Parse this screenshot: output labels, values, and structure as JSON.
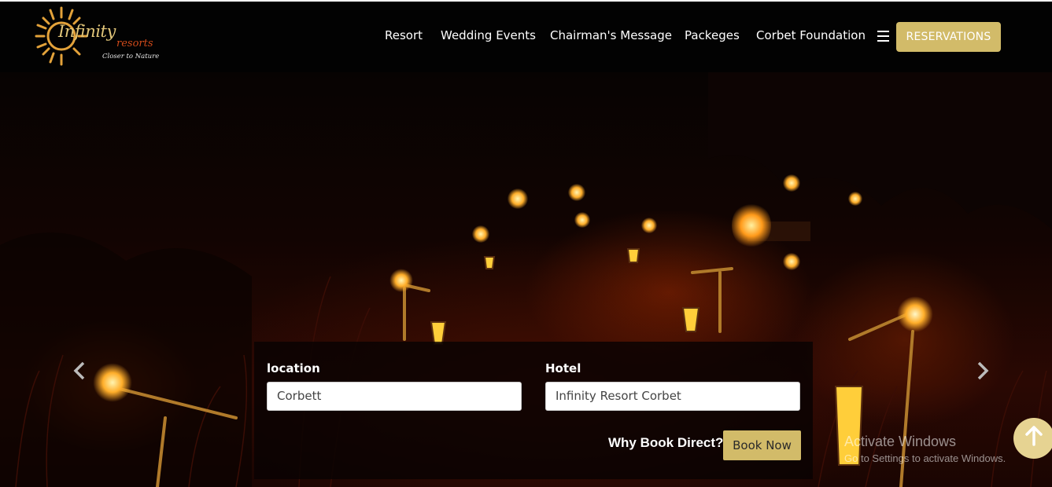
{
  "brand": {
    "logo_main": "Infinity",
    "logo_sub": "resorts",
    "tagline": "Closer to Nature"
  },
  "nav": {
    "items": [
      {
        "label": "Resort"
      },
      {
        "label": "Wedding Events"
      },
      {
        "label": "Chairman's Message"
      },
      {
        "label": "Packeges"
      },
      {
        "label": "Corbet Foundation"
      }
    ],
    "reservations_label": "RESERVATIONS",
    "menu_icon": "hamburger-icon"
  },
  "booking": {
    "location_label": "location",
    "location_value": "Corbett",
    "hotel_label": "Hotel",
    "hotel_value": "Infinity Resort Corbet",
    "why_book_label": "Why Book Direct?",
    "book_now_label": "Book Now"
  },
  "carousel": {
    "prev_icon": "chevron-left-icon",
    "next_icon": "chevron-right-icon"
  },
  "watermark": {
    "title": "Activate Windows",
    "subtitle": "Go to Settings to activate Windows."
  },
  "scroll_top_icon": "arrow-up-icon",
  "colors": {
    "accent": "#d2bb69",
    "header_bg": "#020202",
    "scroll_top_bg": "#e6d392"
  }
}
